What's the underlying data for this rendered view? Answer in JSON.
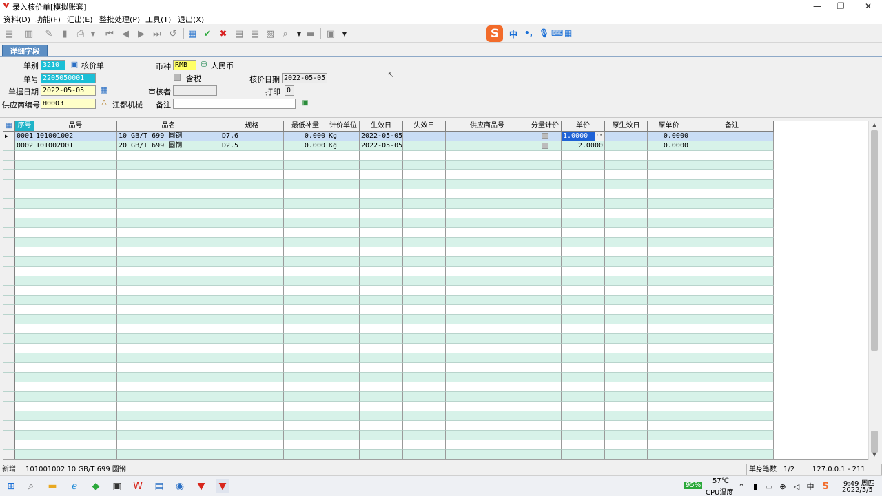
{
  "window": {
    "title": "录入核价单[模拟账套]",
    "min_glyph": "—",
    "max_glyph": "❐",
    "close_glyph": "✕"
  },
  "menu": [
    {
      "label": "资料(D)"
    },
    {
      "label": "功能(F)"
    },
    {
      "label": "汇出(E)"
    },
    {
      "label": "整批处理(P)"
    },
    {
      "label": "工具(T)"
    },
    {
      "label": "退出(X)"
    }
  ],
  "ime": {
    "logo": "S",
    "lang": "中",
    "punct": "•,"
  },
  "tab": {
    "label": "详细字段"
  },
  "form": {
    "doc_type_label": "单别",
    "doc_type_value": "3210",
    "doc_type_name": "核价单",
    "doc_no_label": "单号",
    "doc_no_value": "2205050001",
    "doc_date_label": "单据日期",
    "doc_date_value": "2022-05-05",
    "supplier_label": "供应商编号",
    "supplier_value": "H0003",
    "supplier_name": "江都机械",
    "currency_label": "币种",
    "currency_value": "RMB",
    "currency_name": "人民币",
    "tax_label": "含税",
    "reviewer_label": "审核者",
    "reviewer_value": "",
    "remark_label": "备注",
    "remark_value": "",
    "price_date_label": "核价日期",
    "price_date_value": "2022-05-05",
    "print_label": "打印",
    "print_value": "0"
  },
  "grid": {
    "columns": [
      "序号",
      "品号",
      "品名",
      "规格",
      "最低补量",
      "计价单位",
      "生效日",
      "失效日",
      "供应商品号",
      "分量计价",
      "单价",
      "原生效日",
      "原单价",
      "备注"
    ],
    "rows": [
      {
        "seq": "0001",
        "item_no": "101001002",
        "item_name": "10 GB/T 699 圆钢",
        "spec": "D7.6",
        "min_qty": "0.000",
        "unit": "Kg",
        "eff_date": "2022-05-05",
        "exp_date": "",
        "supplier_item": "",
        "unit_price": "1.0000",
        "orig_eff_date": "",
        "orig_price": "0.0000",
        "remark": ""
      },
      {
        "seq": "0002",
        "item_no": "101002001",
        "item_name": "20 GB/T 699 圆钢",
        "spec": "D2.5",
        "min_qty": "0.000",
        "unit": "Kg",
        "eff_date": "2022-05-05",
        "exp_date": "",
        "supplier_item": "",
        "unit_price": "2.0000",
        "orig_eff_date": "",
        "orig_price": "0.0000",
        "remark": ""
      }
    ]
  },
  "status": {
    "mode": "新增",
    "info": "101001002 10 GB/T 699 圆钢",
    "count_label": "单身笔数",
    "count_value": "1/2",
    "server": "127.0.0.1 - 211"
  },
  "taskbar": {
    "battery": "95%",
    "temp": "57℃",
    "temp_label": "CPU温度",
    "time": "9:49 周四",
    "date": "2022/5/5"
  }
}
